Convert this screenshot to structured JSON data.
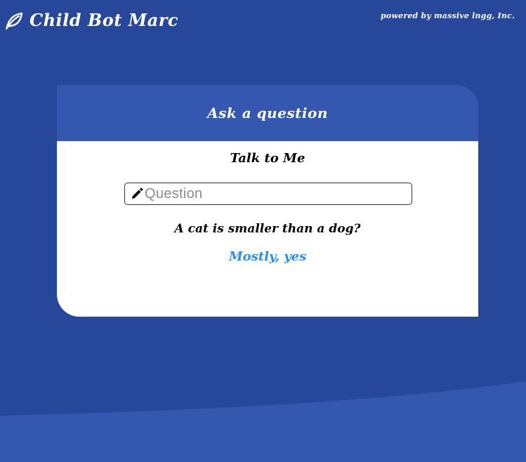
{
  "header": {
    "app_title": "Child Bot Marc",
    "logo_icon": "leaf-icon",
    "powered_by": "powered by massive lngg, Inc."
  },
  "card": {
    "header_title": "Ask a question",
    "body_title": "Talk to Me",
    "input": {
      "icon": "pencil-icon",
      "placeholder": "Question",
      "value": ""
    },
    "asked_question": "A cat is smaller than a dog?",
    "answer": "Mostly, yes"
  },
  "colors": {
    "background": "#26479a",
    "card_header": "#3458b0",
    "answer": "#2f8cf0",
    "wave": "#3458b0"
  }
}
